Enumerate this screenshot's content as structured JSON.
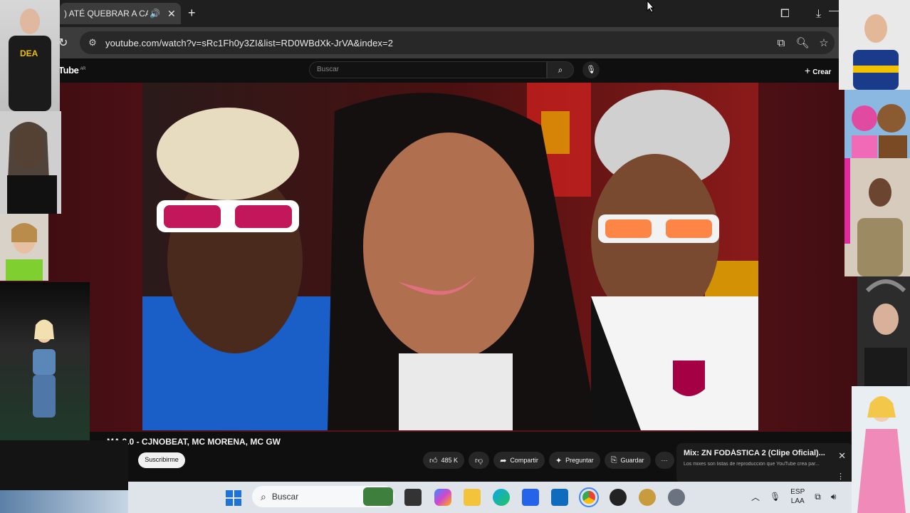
{
  "browser": {
    "tab_title": ") ATÉ QUEBRAR A CAMA",
    "tab_audio_icon": "speaker-icon",
    "tab_close": "✕",
    "new_tab": "+",
    "url": "youtube.com/watch?v=sRc1Fh0y3ZI&list=RD0WBdXk-JrVA&index=2"
  },
  "youtube": {
    "logo": "Tube",
    "logo_region": "AR",
    "search_placeholder": "Buscar",
    "create_label": "Crear"
  },
  "video": {
    "title": "MA 2.0 - CJNOBEAT, MC MORENA, MC GW",
    "subscribe": "Suscribirme",
    "likes": "485 K",
    "share": "Compartir",
    "ask": "Preguntar",
    "save": "Guardar",
    "more": "···"
  },
  "mix": {
    "title": "Mix: ZN FODÁSTICA 2 (Clipe Oficial)...",
    "subtitle": "Los mixes son listas de reproducción que YouTube crea par..."
  },
  "taskbar": {
    "search_label": "Buscar",
    "lang_top": "ESP",
    "lang_bottom": "LAA"
  },
  "overlays": {
    "badge_text": "DEA"
  },
  "colors": {
    "accent_red": "#c62828",
    "chrome_dark": "#1f1f1f",
    "taskbar": "#dfe3ea"
  }
}
